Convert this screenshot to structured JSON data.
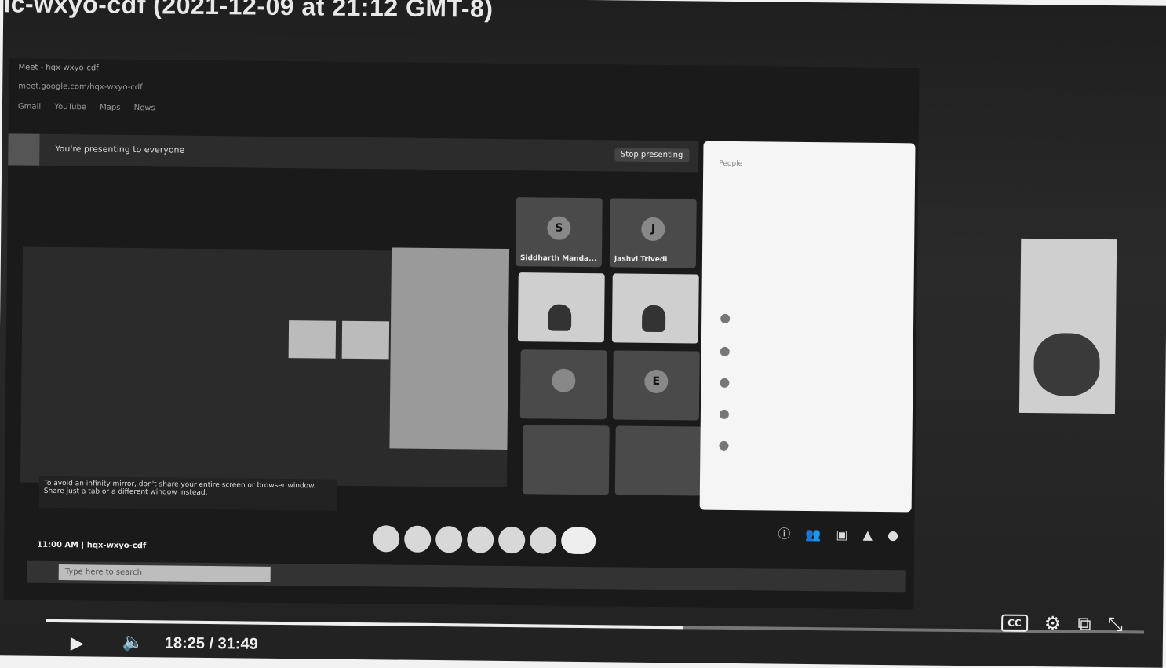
{
  "video": {
    "title": "ic-wxyo-cdf (2021-12-09 at 21:12 GMT-8)"
  },
  "browser": {
    "tabs": [
      "Meet - hqx-wxyo-cdf"
    ],
    "address": "meet.google.com/hqx-wxyo-cdf",
    "bookmarks": [
      "Gmail",
      "YouTube",
      "Maps",
      "News"
    ]
  },
  "meet": {
    "presenting_banner": "You're presenting to everyone",
    "stop_presenting": "Stop presenting",
    "meeting_label": "11:00 AM | hqx-wxyo-cdf",
    "warning": "To avoid an infinity mirror, don't share your entire screen or browser window. Share just a tab or a different window instead.",
    "participants": [
      {
        "name": "Siddharth Manda...",
        "initial": "S",
        "camera": false
      },
      {
        "name": "Jashvi Trivedi",
        "initial": "J",
        "camera": false
      },
      {
        "name": "",
        "initial": "",
        "camera": true
      },
      {
        "name": "",
        "initial": "",
        "camera": true
      },
      {
        "name": "",
        "initial": "",
        "camera": false
      },
      {
        "name": "",
        "initial": "E",
        "camera": false
      },
      {
        "name": "",
        "initial": "",
        "camera": false
      },
      {
        "name": "",
        "initial": "",
        "camera": false
      }
    ],
    "panel_title": "People"
  },
  "taskbar": {
    "search_placeholder": "Type here to search"
  },
  "player": {
    "time": "18:25 / 31:49",
    "progress": 0.58,
    "cc_label": "CC"
  },
  "icons": {
    "play": "play-icon",
    "volume": "volume-icon",
    "settings": "gear-icon",
    "miniplayer": "miniplayer-icon",
    "exit_fullscreen": "exit-fullscreen-icon"
  }
}
